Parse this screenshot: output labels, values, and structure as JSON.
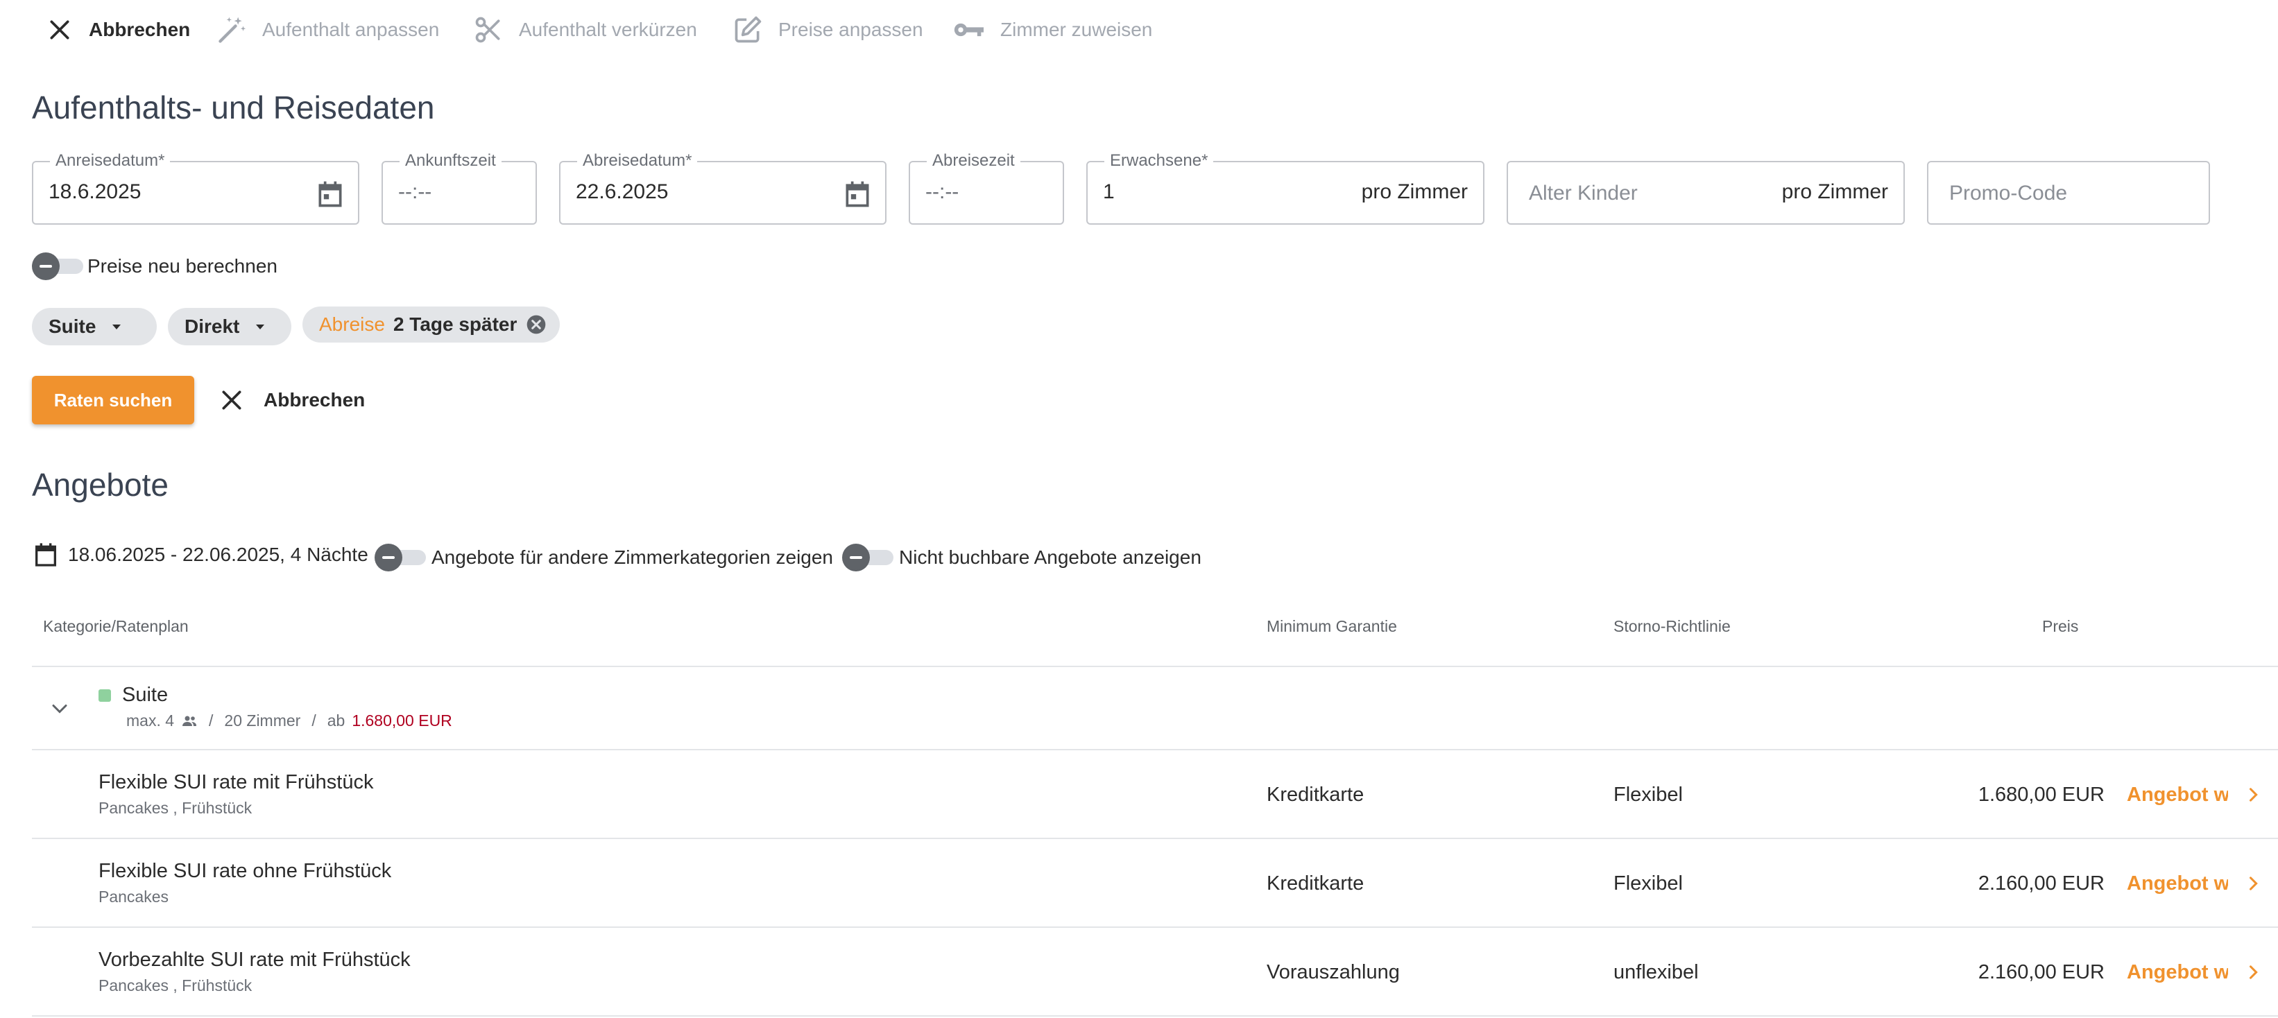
{
  "colors": {
    "accent": "#f0922e",
    "price_red": "#b00020",
    "category_dot": "#8fd19e"
  },
  "toolbar": {
    "cancel": "Abbrechen",
    "adjust_stay": "Aufenthalt anpassen",
    "shorten_stay": "Aufenthalt verkürzen",
    "adjust_prices": "Preise anpassen",
    "assign_room": "Zimmer zuweisen"
  },
  "stay": {
    "title": "Aufenthalts- und Reisedaten",
    "arrival_date": {
      "label": "Anreisedatum*",
      "value": "18.6.2025"
    },
    "arrival_time": {
      "label": "Ankunftszeit",
      "value": "--:--"
    },
    "departure_date": {
      "label": "Abreisedatum*",
      "value": "22.6.2025"
    },
    "departure_time": {
      "label": "Abreisezeit",
      "value": "--:--"
    },
    "adults": {
      "label": "Erwachsene*",
      "value": "1",
      "suffix": "pro Zimmer"
    },
    "children_ages": {
      "placeholder": "Alter Kinder",
      "suffix": "pro Zimmer"
    },
    "promo_code": {
      "placeholder": "Promo-Code"
    },
    "recalc_label": "Preise neu berechnen",
    "filters": {
      "category": "Suite",
      "channel": "Direkt"
    },
    "change_chip": {
      "prefix": "Abreise",
      "text": "2 Tage später"
    },
    "search_button": "Raten suchen",
    "cancel_button": "Abbrechen"
  },
  "offers": {
    "title": "Angebote",
    "period": "18.06.2025 - 22.06.2025, 4 Nächte",
    "toggle_other_categories": "Angebote für andere Zimmerkategorien zeigen",
    "toggle_unbookable": "Nicht buchbare Angebote anzeigen",
    "columns": {
      "category": "Kategorie/Ratenplan",
      "guarantee": "Minimum Garantie",
      "cancellation": "Storno-Richtlinie",
      "price": "Preis"
    },
    "group": {
      "name": "Suite",
      "max_guests": "max. 4",
      "sep1": "/",
      "rooms": "20 Zimmer",
      "sep2": "/",
      "from_prefix": "ab",
      "from_price": "1.680,00 EUR"
    },
    "rows": [
      {
        "name": "Flexible SUI rate mit Frühstück",
        "services": "Pancakes , Frühstück",
        "guarantee": "Kreditkarte",
        "cancellation": "Flexibel",
        "price": "1.680,00 EUR",
        "action": "Angebot wählen"
      },
      {
        "name": "Flexible SUI rate ohne Frühstück",
        "services": "Pancakes",
        "guarantee": "Kreditkarte",
        "cancellation": "Flexibel",
        "price": "2.160,00 EUR",
        "action": "Angebot wählen"
      },
      {
        "name": "Vorbezahlte SUI rate mit Frühstück",
        "services": "Pancakes , Frühstück",
        "guarantee": "Vorauszahlung",
        "cancellation": "unflexibel",
        "price": "2.160,00 EUR",
        "action": "Angebot wählen"
      }
    ]
  }
}
